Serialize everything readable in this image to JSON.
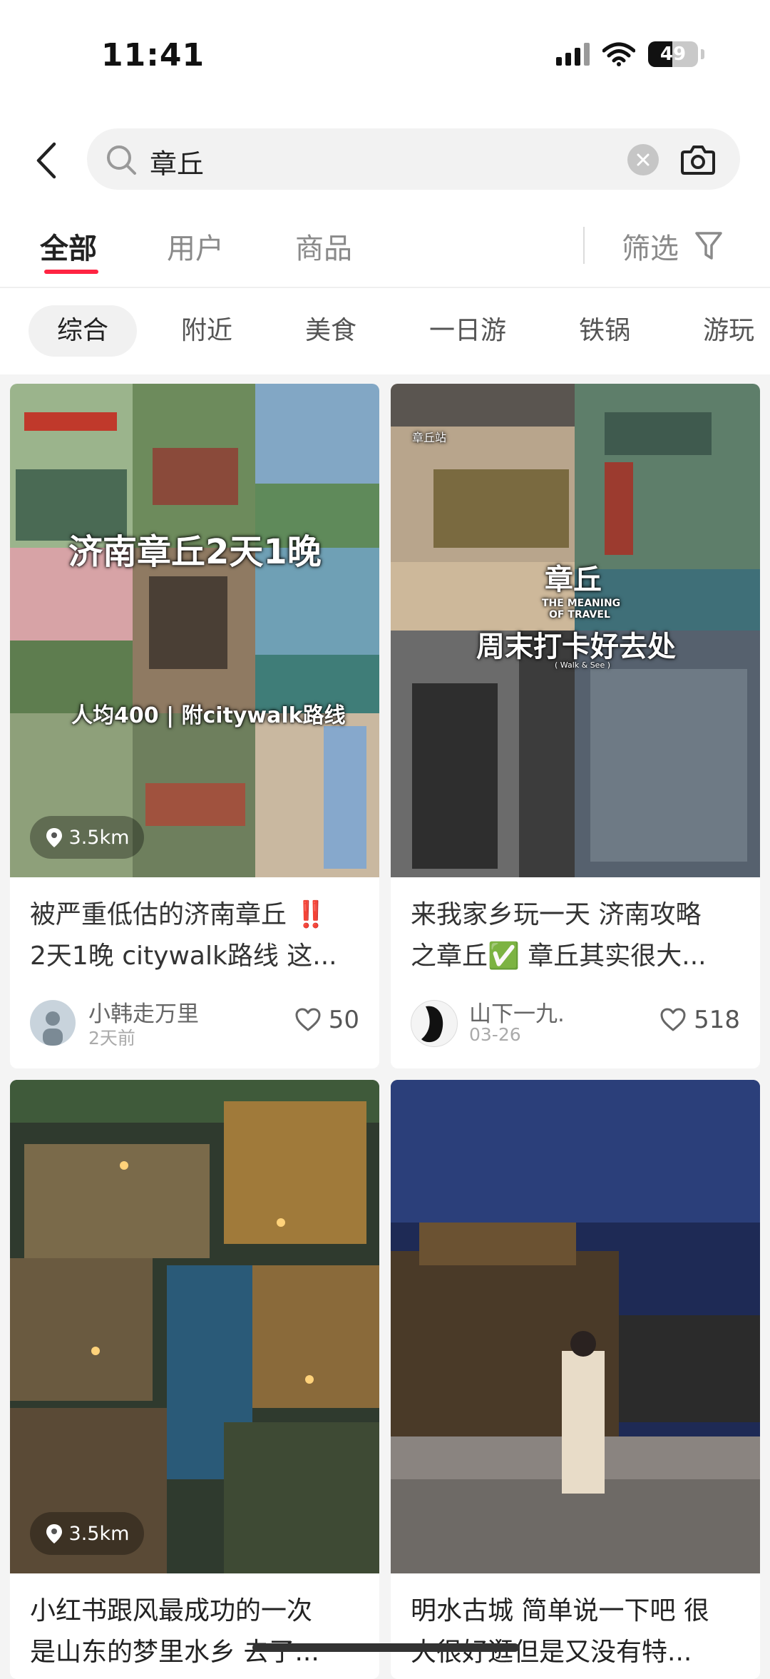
{
  "status_bar": {
    "time": "11:41",
    "battery": "49"
  },
  "search": {
    "query": "章丘"
  },
  "tabs": [
    {
      "label": "全部",
      "active": true
    },
    {
      "label": "用户",
      "active": false
    },
    {
      "label": "商品",
      "active": false
    }
  ],
  "filter_label": "筛选",
  "chips": [
    "综合",
    "附近",
    "美食",
    "一日游",
    "铁锅",
    "游玩"
  ],
  "cards": [
    {
      "overlay_title": "济南章丘2天1晚",
      "overlay_sub": "人均400 | 附citywalk路线",
      "distance": "3.5km",
      "title_line1": "被严重低估的济南章丘 ‼️",
      "title_line2": "2天1晚 citywalk路线 这...",
      "author": "小韩走万里",
      "date": "2天前",
      "likes": "50"
    },
    {
      "overlay_station": "章丘站",
      "overlay_title": "章丘",
      "overlay_en1": "THE MEANING",
      "overlay_en2": "OF TRAVEL",
      "overlay_sub": "周末打卡好去处",
      "overlay_tiny": "( Walk & See )",
      "title_line1": "来我家乡玩一天 济南攻略",
      "title_line2": "之章丘✅ 章丘其实很大...",
      "author": "山下一九.",
      "date": "03-26",
      "likes": "518"
    },
    {
      "distance": "3.5km",
      "title_line1": "小红书跟风最成功的一次",
      "title_line2": "是山东的梦里水乡 去了..."
    },
    {
      "title_line1": "明水古城 简单说一下吧 很",
      "title_line2": "大很好逛但是又没有特..."
    }
  ],
  "colors": {
    "accent": "#ff2442",
    "background": "#f4f4f4"
  }
}
